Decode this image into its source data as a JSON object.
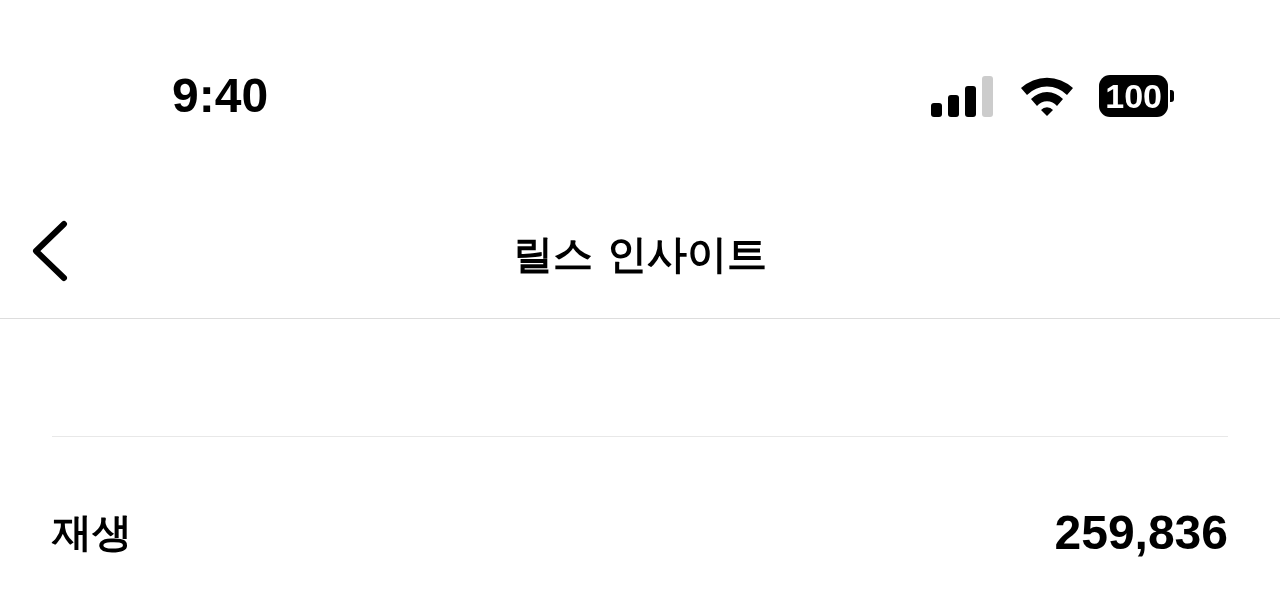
{
  "status_bar": {
    "time": "9:40",
    "battery": "100"
  },
  "header": {
    "title": "릴스 인사이트"
  },
  "stats": [
    {
      "label": "재생",
      "value": "259,836"
    }
  ]
}
